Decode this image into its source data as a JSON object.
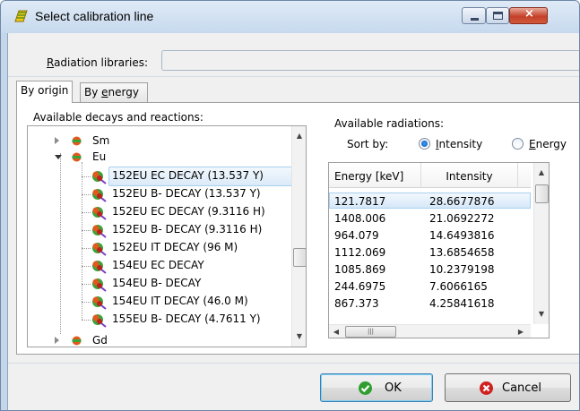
{
  "window": {
    "title": "Select calibration line",
    "close_glyph": "×"
  },
  "libraries": {
    "label_prefix": "R",
    "label_rest": "adiation libraries:",
    "value": ""
  },
  "tabs": [
    {
      "label": "By origin",
      "active": true
    },
    {
      "label_prefix": "By ",
      "label_ul": "e",
      "label_rest": "nergy",
      "active": false
    }
  ],
  "decays": {
    "label": "Available decays and reactions:",
    "items": [
      {
        "label": "Sm",
        "type": "element",
        "expanded": false
      },
      {
        "label": "Eu",
        "type": "element",
        "expanded": true
      },
      {
        "label": "152EU EC DECAY (13.537 Y)",
        "type": "decay",
        "selected": true
      },
      {
        "label": "152EU B- DECAY (13.537 Y)",
        "type": "decay"
      },
      {
        "label": "152EU EC DECAY (9.3116 H)",
        "type": "decay"
      },
      {
        "label": "152EU B- DECAY (9.3116 H)",
        "type": "decay"
      },
      {
        "label": "152EU IT DECAY (96 M)",
        "type": "decay"
      },
      {
        "label": "154EU EC DECAY",
        "type": "decay"
      },
      {
        "label": "154EU B- DECAY",
        "type": "decay"
      },
      {
        "label": "154EU IT DECAY (46.0 M)",
        "type": "decay"
      },
      {
        "label": "155EU B- DECAY (4.7611 Y)",
        "type": "decay"
      },
      {
        "label": "Gd",
        "type": "element",
        "expanded": false
      }
    ]
  },
  "radiations": {
    "label": "Available radiations:",
    "sort_by": "Sort by:",
    "sort_options": [
      {
        "ul": "I",
        "rest": "ntensity",
        "selected": true
      },
      {
        "ul": "E",
        "rest": "nergy",
        "selected": false
      }
    ],
    "columns": [
      "Energy [keV]",
      "Intensity"
    ],
    "rows": [
      {
        "energy": "121.7817",
        "intensity": "28.6677876",
        "selected": true
      },
      {
        "energy": "1408.006",
        "intensity": "21.0692272"
      },
      {
        "energy": "964.079",
        "intensity": "14.6493816"
      },
      {
        "energy": "1112.069",
        "intensity": "13.6854658"
      },
      {
        "energy": "1085.869",
        "intensity": "10.2379198"
      },
      {
        "energy": "244.6975",
        "intensity": "7.6066165"
      },
      {
        "energy": "867.373",
        "intensity": "4.25841618"
      }
    ]
  },
  "buttons": {
    "ok": "OK",
    "cancel": "Cancel"
  },
  "colors": {
    "title_bar": "#c7d9ee",
    "selection": "#dbeaf8",
    "ok_icon": "#2f9e2f",
    "cancel_icon": "#d02020",
    "element_icon": "#e05a1e",
    "element_icon_green": "#3aa33a"
  },
  "icons": {
    "app": "calibration-app-icon",
    "element": "element-node-icon",
    "decay": "radiation-decay-icon",
    "ok": "check-icon",
    "cancel": "x-circle-icon"
  }
}
